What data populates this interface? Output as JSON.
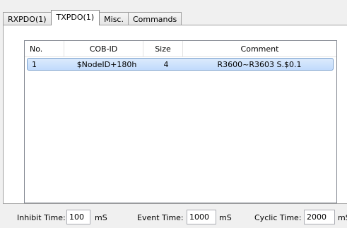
{
  "tabs": [
    {
      "label": "RXPDO(1)"
    },
    {
      "label": "TXPDO(1)"
    },
    {
      "label": "Misc."
    },
    {
      "label": "Commands"
    }
  ],
  "table": {
    "columns": [
      "No.",
      "COB-ID",
      "Size",
      "Comment"
    ],
    "rows": [
      {
        "no": "1",
        "cob_id": "$NodeID+180h",
        "size": "4",
        "comment": "R3600~R3603 S.$0.1"
      }
    ]
  },
  "footer": {
    "inhibit_label": "Inhibit Time:",
    "inhibit_value": "100",
    "inhibit_unit": "mS",
    "event_label": "Event Time:",
    "event_value": "1000",
    "event_unit": "mS",
    "cyclic_label": "Cyclic Time:",
    "cyclic_value": "2000",
    "cyclic_unit": "mS"
  }
}
